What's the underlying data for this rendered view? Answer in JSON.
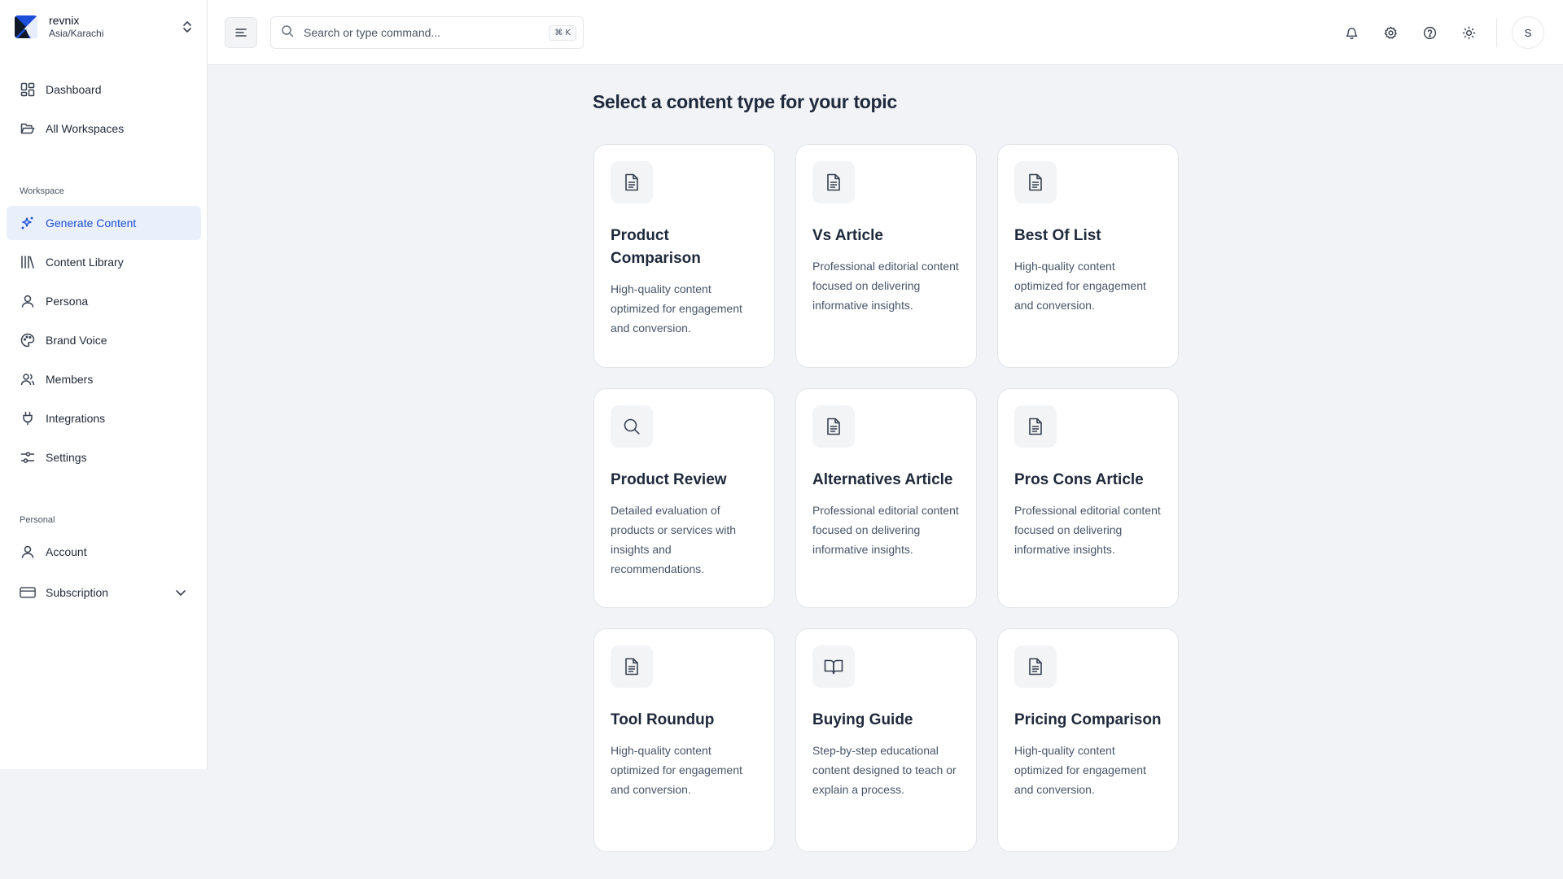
{
  "brand": {
    "name": "revnix",
    "timezone": "Asia/Karachi"
  },
  "nav_main": [
    {
      "label": "Dashboard",
      "icon": "dashboard-icon"
    },
    {
      "label": "All Workspaces",
      "icon": "folder-open-icon"
    }
  ],
  "sections": {
    "workspace": "Workspace",
    "personal": "Personal"
  },
  "nav_workspace": [
    {
      "label": "Generate Content",
      "icon": "sparkles-icon",
      "active": true
    },
    {
      "label": "Content Library",
      "icon": "library-icon"
    },
    {
      "label": "Persona",
      "icon": "user-icon"
    },
    {
      "label": "Brand Voice",
      "icon": "palette-icon"
    },
    {
      "label": "Members",
      "icon": "users-icon"
    },
    {
      "label": "Integrations",
      "icon": "plug-icon"
    },
    {
      "label": "Settings",
      "icon": "sliders-icon"
    }
  ],
  "nav_personal": [
    {
      "label": "Account",
      "icon": "user-icon"
    },
    {
      "label": "Subscription",
      "icon": "credit-card-icon"
    }
  ],
  "topbar": {
    "search_placeholder": "Search or type command...",
    "shortcut": "⌘ K",
    "avatar_initial": "S"
  },
  "main": {
    "title": "Select a content type for your topic",
    "cards": [
      {
        "title": "Product Comparison",
        "desc": "High-quality content optimized for engagement and conversion.",
        "icon": "file-text-icon"
      },
      {
        "title": "Vs Article",
        "desc": "Professional editorial content focused on delivering informative insights.",
        "icon": "file-text-icon"
      },
      {
        "title": "Best Of List",
        "desc": "High-quality content optimized for engagement and conversion.",
        "icon": "file-text-icon"
      },
      {
        "title": "Product Review",
        "desc": "Detailed evaluation of products or services with insights and recommendations.",
        "icon": "search-icon"
      },
      {
        "title": "Alternatives Article",
        "desc": "Professional editorial content focused on delivering informative insights.",
        "icon": "file-text-icon"
      },
      {
        "title": "Pros Cons Article",
        "desc": "Professional editorial content focused on delivering informative insights.",
        "icon": "file-text-icon"
      },
      {
        "title": "Tool Roundup",
        "desc": "High-quality content optimized for engagement and conversion.",
        "icon": "file-text-icon"
      },
      {
        "title": "Buying Guide",
        "desc": "Step-by-step educational content designed to teach or explain a process.",
        "icon": "book-open-icon"
      },
      {
        "title": "Pricing Comparison",
        "desc": "High-quality content optimized for engagement and conversion.",
        "icon": "file-text-icon"
      }
    ]
  },
  "colors": {
    "accent": "#1d4ed8",
    "active_bg": "#eaf0fb",
    "page_bg": "#f1f3f6",
    "logo_blue": "#1d4ed8"
  }
}
